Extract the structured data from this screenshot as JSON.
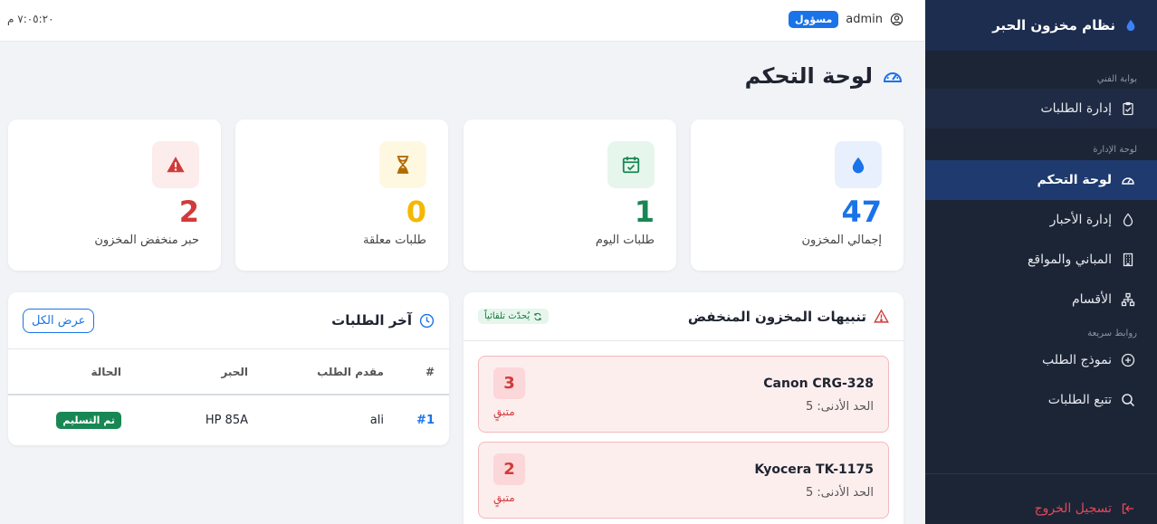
{
  "app": {
    "brand_title": "نظام مخزون الحبر"
  },
  "sidebar": {
    "section_tech": "بوابة الفني",
    "section_admin": "لوحة الإدارة",
    "section_quick": "روابط سريعة",
    "items": [
      {
        "label": "إدارة الطلبات",
        "icon": "clipboard-check-icon"
      },
      {
        "label": "لوحة التحكم",
        "icon": "speedometer-icon"
      },
      {
        "label": "إدارة الأحبار",
        "icon": "droplet-icon"
      },
      {
        "label": "المباني والمواقع",
        "icon": "building-icon"
      },
      {
        "label": "الأقسام",
        "icon": "diagram-icon"
      },
      {
        "label": "نموذج الطلب",
        "icon": "plus-circle-icon"
      },
      {
        "label": "تتبع الطلبات",
        "icon": "search-icon"
      }
    ],
    "logout_label": "تسجيل الخروج"
  },
  "topbar": {
    "username": "admin",
    "role": "مسؤول",
    "time": "٧:٠٥:٢٠ م"
  },
  "page": {
    "title": "لوحة التحكم"
  },
  "stats": [
    {
      "value": "47",
      "label": "إجمالي المخزون",
      "color": "#1a73e8",
      "bg": "#e8f0fe",
      "icon": "droplet-icon"
    },
    {
      "value": "1",
      "label": "طلبات اليوم",
      "color": "#198754",
      "bg": "#e7f6ec",
      "icon": "calendar-check-icon"
    },
    {
      "value": "0",
      "label": "طلبات معلقة",
      "color": "#f5b800",
      "bg": "#fff8e1",
      "icon": "hourglass-icon"
    },
    {
      "value": "2",
      "label": "حبر منخفض المخزون",
      "color": "#d13a3a",
      "bg": "#fdecec",
      "icon": "warning-icon"
    }
  ],
  "alerts_panel": {
    "title": "تنبيهات المخزون المنخفض",
    "auto_badge": "يُحدّث تلقائياً",
    "items": [
      {
        "name": "Canon CRG-328",
        "min_label": "الحد الأدنى: 5",
        "count": "3",
        "remaining_label": "متبقٍ"
      },
      {
        "name": "Kyocera TK-1175",
        "min_label": "الحد الأدنى: 5",
        "count": "2",
        "remaining_label": "متبقٍ"
      }
    ]
  },
  "orders_panel": {
    "title": "آخر الطلبات",
    "view_all": "عرض الكل",
    "columns": [
      "#",
      "مقدم الطلب",
      "الحبر",
      "الحالة"
    ],
    "rows": [
      {
        "id": "#1",
        "requester": "ali",
        "ink": "HP 85A",
        "status": "تم التسليم"
      }
    ]
  }
}
